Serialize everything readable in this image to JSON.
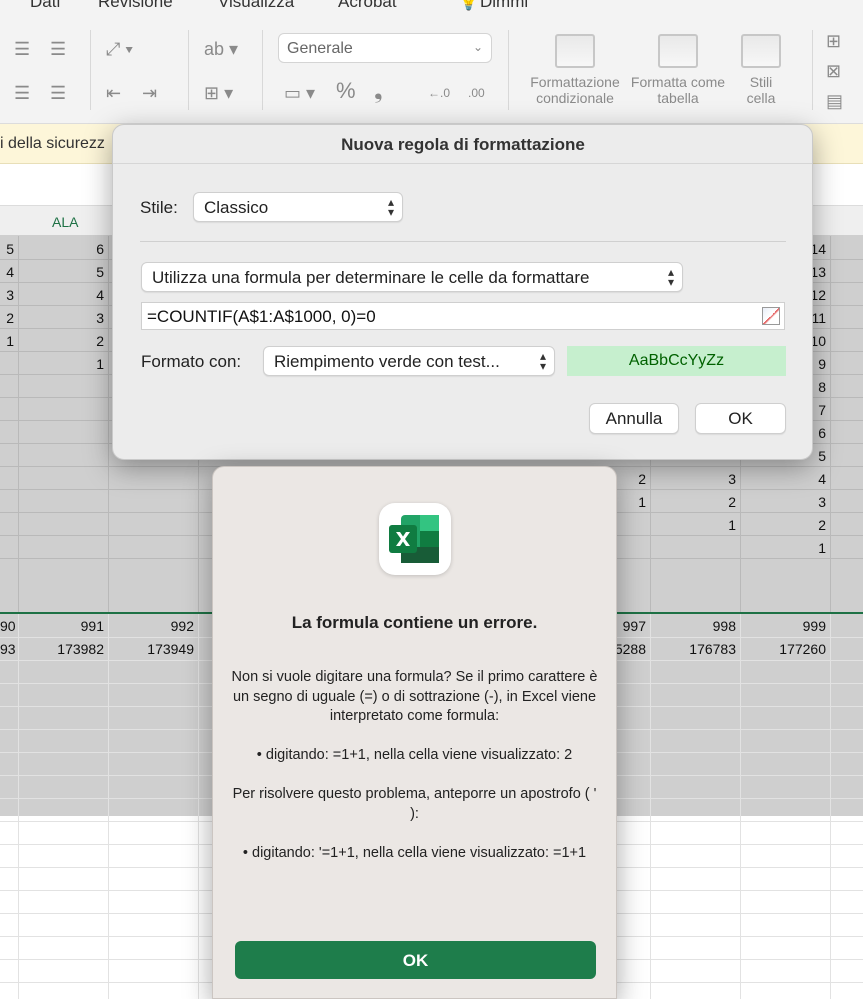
{
  "ribbon": {
    "tabs": [
      "Dati",
      "Revisione",
      "Visualizza",
      "Acrobat",
      "Dimmi"
    ],
    "number_format": "Generale",
    "buttons": {
      "conditional_formatting": "Formattazione condizionale",
      "format_as_table": "Formatta come tabella",
      "cell_styles": "Stili cella"
    }
  },
  "security_bar": {
    "text": "i della sicurezz"
  },
  "sheet": {
    "column_header": "ALA",
    "left_col": [
      "5",
      "4",
      "3",
      "2",
      "1"
    ],
    "second_col": [
      "6",
      "5",
      "4",
      "3",
      "2",
      "1"
    ],
    "right_col": [
      "14",
      "13",
      "12",
      "11",
      "10",
      "9",
      "8",
      "7",
      "6",
      "5",
      "4",
      "3",
      "2",
      "1"
    ],
    "mid_col_a": [
      "2",
      "1"
    ],
    "mid_col_b": [
      "3",
      "2",
      "1"
    ],
    "row_numbers": [
      "90",
      "991",
      "992",
      "997",
      "998",
      "999"
    ],
    "row_values": [
      "93",
      "173982",
      "173949",
      "5288",
      "176783",
      "177260"
    ]
  },
  "rule_dialog": {
    "title": "Nuova regola di formattazione",
    "style_label": "Stile:",
    "style_value": "Classico",
    "rule_type": "Utilizza una formula per determinare le celle da formattare",
    "formula": "=COUNTIF(A$1:A$1000, 0)=0",
    "format_label": "Formato con:",
    "format_value": "Riempimento verde con test...",
    "preview_text": "AaBbCcYyZz",
    "cancel": "Annulla",
    "ok": "OK"
  },
  "error_dialog": {
    "title": "La formula contiene un errore.",
    "paragraphs": [
      "Non si vuole digitare una formula? Se il primo carattere è un segno di uguale (=) o di sottrazione (-), in Excel viene interpretato come formula:",
      "• digitando: =1+1, nella cella viene visualizzato: 2",
      "Per risolvere questo problema, anteporre un apostrofo ( ' ):",
      "• digitando: '=1+1, nella cella viene visualizzato: =1+1"
    ],
    "ok": "OK"
  },
  "colors": {
    "excel_green": "#1e7145",
    "ok_button": "#1e7d4b",
    "preview_fill": "#c6efce",
    "preview_text": "#006100"
  }
}
